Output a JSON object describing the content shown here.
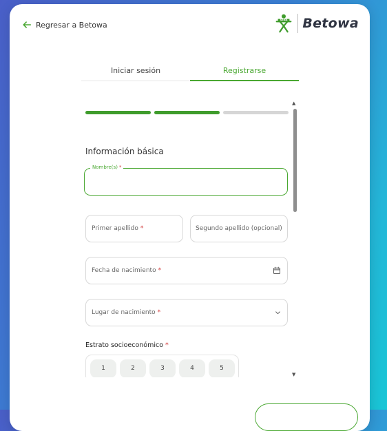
{
  "header": {
    "back_label": "Regresar a Betowa",
    "brand_name": "Betowa",
    "brand_color": "#2f3442",
    "logo": "sena-logo"
  },
  "tabs": [
    {
      "label": "Iniciar sesión",
      "active": false
    },
    {
      "label": "Registrarse",
      "active": true
    }
  ],
  "accent_color": "#4aa832",
  "progress": {
    "total_steps": 3,
    "completed_steps": 2
  },
  "form": {
    "section_title": "Información básica",
    "nombre": {
      "label": "Nombre(s)",
      "required_mark": "*",
      "value": ""
    },
    "primer_apellido": {
      "placeholder": "Primer apellido",
      "required_mark": "*"
    },
    "segundo_apellido": {
      "placeholder": "Segundo apellido (opcional)"
    },
    "fecha_nacimiento": {
      "placeholder": "Fecha de nacimiento",
      "required_mark": "*",
      "icon": "calendar-icon"
    },
    "lugar_nacimiento": {
      "placeholder": "Lugar de nacimiento",
      "required_mark": "*",
      "icon": "chevron-down-icon"
    },
    "estrato": {
      "label": "Estrato socioeconómico",
      "required_mark": "*",
      "options": [
        "1",
        "2",
        "3",
        "4",
        "5"
      ]
    }
  }
}
